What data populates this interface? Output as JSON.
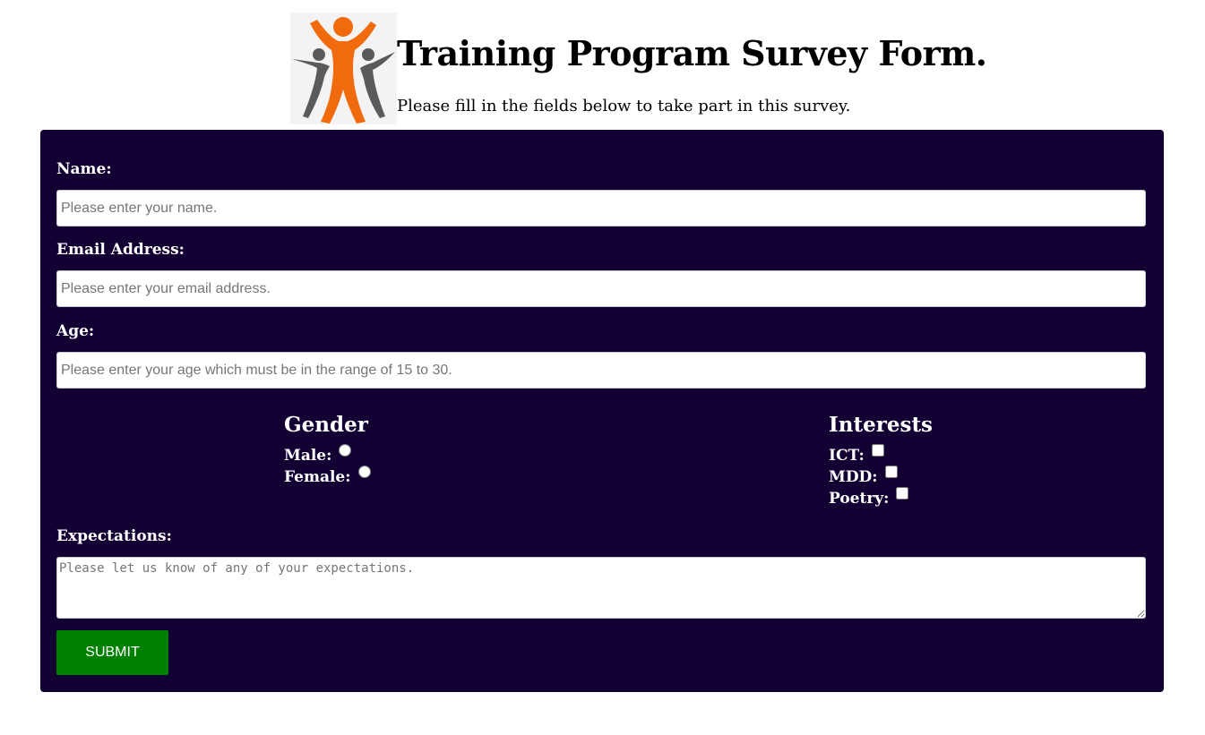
{
  "header": {
    "title": "Training Program Survey Form.",
    "subtitle": "Please fill in the fields below to take part in this survey.",
    "logo_icon": "people-figures-logo-icon",
    "logo_colors": {
      "center": "#f26a0e",
      "sides": "#5a5a5a"
    }
  },
  "form": {
    "background": "#120032",
    "name": {
      "label": "Name:",
      "placeholder": "Please enter your name."
    },
    "email": {
      "label": "Email Address:",
      "placeholder": "Please enter your email address."
    },
    "age": {
      "label": "Age:",
      "placeholder": "Please enter your age which must be in the range of 15 to 30."
    },
    "gender": {
      "title": "Gender",
      "options": [
        {
          "label": "Male:"
        },
        {
          "label": "Female:"
        }
      ]
    },
    "interests": {
      "title": "Interests",
      "options": [
        {
          "label": "ICT:"
        },
        {
          "label": "MDD:"
        },
        {
          "label": "Poetry:"
        }
      ]
    },
    "expectations": {
      "label": "Expectations:",
      "placeholder": "Please let us know of any of your expectations."
    },
    "submit": {
      "label": "SUBMIT",
      "color": "#008000"
    }
  }
}
